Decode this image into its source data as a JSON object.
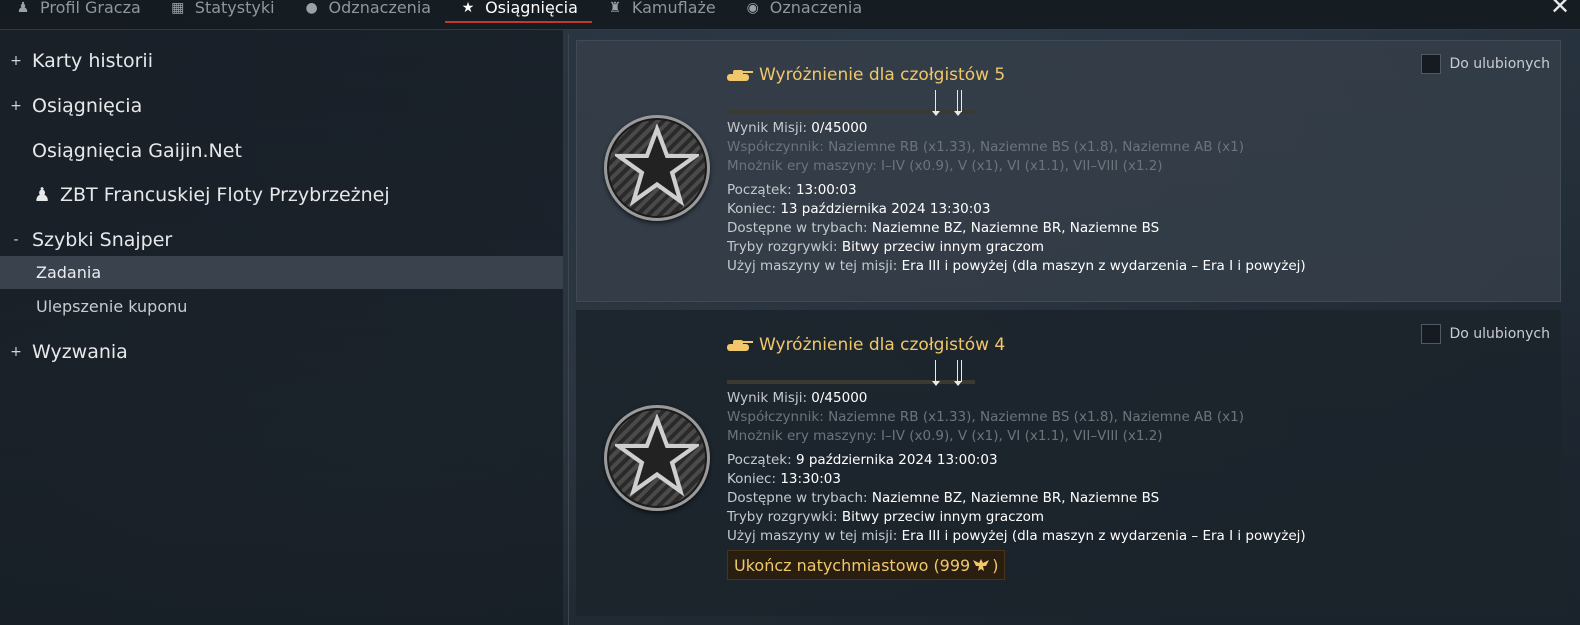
{
  "tabs": [
    {
      "label": "Profil Gracza",
      "icon": "player-profile-icon"
    },
    {
      "label": "Statystyki",
      "icon": "statistics-icon"
    },
    {
      "label": "Odznaczenia",
      "icon": "medal-icon"
    },
    {
      "label": "Osiągnięcia",
      "icon": "star-icon",
      "active": true
    },
    {
      "label": "Kamuflaże",
      "icon": "camouflage-icon"
    },
    {
      "label": "Oznaczenia",
      "icon": "decal-icon"
    }
  ],
  "left_nav": {
    "items": [
      {
        "prefix": "+",
        "label": "Karty historii"
      },
      {
        "prefix": "+",
        "label": "Osiągnięcia"
      },
      {
        "prefix": "",
        "label": "Osiągnięcia Gaijin.Net"
      },
      {
        "prefix": "",
        "label": "ZBT Francuskiej Floty Przybrzeżnej"
      },
      {
        "prefix": "-",
        "label": "Szybki Snajper"
      },
      {
        "prefix": "",
        "label": "Zadania",
        "selected": true
      },
      {
        "prefix": "",
        "label": "Ulepszenie kuponu"
      },
      {
        "prefix": "+",
        "label": "Wyzwania"
      }
    ]
  },
  "cards": [
    {
      "title": "Wyróżnienie dla czołgistów 5",
      "favorite_label": "Do ulubionych",
      "marker_labels": [
        "|",
        "||"
      ],
      "score_label": "Wynik Misji:",
      "score_value": "0/45000",
      "coef_text": "Współczynnik: Naziemne RB (x1.33), Naziemne BS (x1.8), Naziemne AB (x1)",
      "mult_text": "Mnożnik ery maszyny: I–IV (x0.9), V (x1), VI (x1.1), VII–VIII (x1.2)",
      "start_label": "Początek:",
      "start_value": "13:00:03",
      "end_label": "Koniec:",
      "end_value": "13 października 2024 13:30:03",
      "modes_label": "Dostępne w trybach:",
      "modes_value": "Naziemne BZ, Naziemne BR, Naziemne BS",
      "game_label": "Tryby rozgrywki:",
      "game_value": "Bitwy przeciw innym graczom",
      "vehicles_label": "Użyj maszyny w tej misji:",
      "vehicles_value": "Era III i powyżej (dla maszyn z wydarzenia – Era I i powyżej)"
    },
    {
      "title": "Wyróżnienie dla czołgistów 4",
      "favorite_label": "Do ulubionych",
      "marker_labels": [
        "|",
        "||"
      ],
      "score_label": "Wynik Misji:",
      "score_value": "0/45000",
      "coef_text": "Współczynnik: Naziemne RB (x1.33), Naziemne BS (x1.8), Naziemne AB (x1)",
      "mult_text": "Mnożnik ery maszyny: I–IV (x0.9), V (x1), VI (x1.1), VII–VIII (x1.2)",
      "start_label": "Początek:",
      "start_value": "9 października 2024 13:00:03",
      "end_label": "Koniec:",
      "end_value": "13:30:03",
      "modes_label": "Dostępne w trybach:",
      "modes_value": "Naziemne BZ, Naziemne BR, Naziemne BS",
      "game_label": "Tryby rozgrywki:",
      "game_value": "Bitwy przeciw innym graczom",
      "vehicles_label": "Użyj maszyny w tej misji:",
      "vehicles_value": "Era III i powyżej (dla maszyn z wydarzenia – Era I i powyżej)",
      "complete_button": {
        "label": "Ukończ natychmiastowo (999",
        "suffix": ")"
      }
    }
  ],
  "colors": {
    "accent_red": "#c0392b",
    "title_gold": "#f0c76a",
    "muted_text": "#6c747b"
  }
}
